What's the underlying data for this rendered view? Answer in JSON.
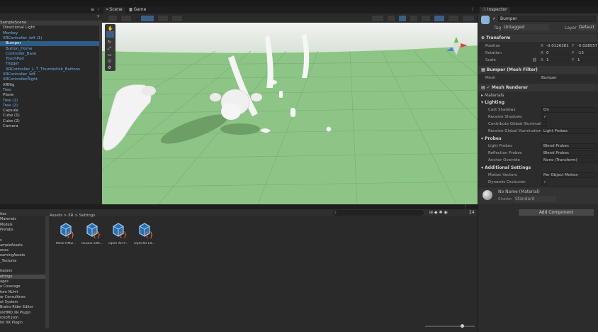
{
  "hierarchy": {
    "tab_icons": [
      "≡",
      "⋮"
    ],
    "plus_icon": "+",
    "items": [
      {
        "label": "SampleScene",
        "cls": "scene",
        "indent": 0
      },
      {
        "label": "Directional Light",
        "cls": "",
        "indent": 4
      },
      {
        "label": "Monkey",
        "cls": "blue",
        "indent": 4
      },
      {
        "label": "XRController_left (1)",
        "cls": "blue",
        "indent": 4
      },
      {
        "label": "Bumper",
        "cls": "blue sel",
        "indent": 8
      },
      {
        "label": "Button_Home",
        "cls": "blue",
        "indent": 8
      },
      {
        "label": "Controller_Base",
        "cls": "blue",
        "indent": 8
      },
      {
        "label": "TouchPad",
        "cls": "blue",
        "indent": 8
      },
      {
        "label": "Trigger",
        "cls": "blue",
        "indent": 8
      },
      {
        "label": "XRController_L_T_Thumbstick_Buttons",
        "cls": "blue",
        "indent": 8
      },
      {
        "label": "XRController_left",
        "cls": "blue",
        "indent": 4
      },
      {
        "label": "XRControllerRight",
        "cls": "blue",
        "indent": 4
      },
      {
        "label": "XRRig",
        "cls": "",
        "indent": 4
      },
      {
        "label": "Tree",
        "cls": "blue",
        "indent": 4
      },
      {
        "label": "Plane",
        "cls": "",
        "indent": 4
      },
      {
        "label": "Tree (1)",
        "cls": "blue",
        "indent": 4
      },
      {
        "label": "Tree (2)",
        "cls": "blue",
        "indent": 4
      },
      {
        "label": "Capsule",
        "cls": "",
        "indent": 4
      },
      {
        "label": "Cube (1)",
        "cls": "",
        "indent": 4
      },
      {
        "label": "Cube (2)",
        "cls": "",
        "indent": 4
      },
      {
        "label": "Camera",
        "cls": "",
        "indent": 4
      }
    ]
  },
  "scene": {
    "tabs": [
      {
        "label": "Scene",
        "active": true
      },
      {
        "label": "Game",
        "active": false
      }
    ],
    "persp_label": "",
    "toolbar_right": [
      "2D",
      "☀",
      "◉",
      "⊞",
      "▾"
    ]
  },
  "inspector": {
    "tab": "Inspector",
    "object_name": "Bumper",
    "tag_label": "Tag",
    "tag_value": "Untagged",
    "layer_label": "Layer",
    "layer_value": "Default",
    "transform": {
      "title": "Transform",
      "rows": [
        {
          "label": "Position",
          "x": "-0.0126381",
          "y": "-0.028557",
          "z": ""
        },
        {
          "label": "Rotation",
          "x": "0",
          "y": "-15",
          "z": ""
        },
        {
          "label": "Scale",
          "x": "1",
          "y": "1",
          "z": ""
        }
      ]
    },
    "mesh_filter": {
      "title": "Bumper (Mesh Filter)",
      "mesh_label": "Mesh",
      "mesh_value": "Bumper"
    },
    "mesh_renderer": {
      "title": "Mesh Renderer",
      "materials": "Materials",
      "lighting": "Lighting",
      "lighting_rows": [
        {
          "label": "Cast Shadows",
          "value": "On"
        },
        {
          "label": "Receive Shadows",
          "value": "✓"
        },
        {
          "label": "Contribute Global Illumination",
          "value": ""
        },
        {
          "label": "Receive Global Illumination",
          "value": "Light Probes"
        }
      ],
      "probes": "Probes",
      "probes_rows": [
        {
          "label": "Light Probes",
          "value": "Blend Probes"
        },
        {
          "label": "Reflection Probes",
          "value": "Blend Probes"
        },
        {
          "label": "Anchor Override",
          "value": "None (Transform)"
        }
      ],
      "additional": "Additional Settings",
      "additional_rows": [
        {
          "label": "Motion Vectors",
          "value": "Per Object Motion"
        },
        {
          "label": "Dynamic Occlusion",
          "value": "✓"
        }
      ]
    },
    "material": {
      "name": "No Name (Material)",
      "shader_label": "Shader",
      "shader_value": "Standard"
    },
    "add_component": "Add Component"
  },
  "project": {
    "breadcrumb": "Assets > XR > Settings",
    "left_items": [
      "ites",
      "Materials",
      "Models",
      "Prefabs",
      "",
      "s",
      "ampleAssets",
      "enes",
      "earningAssets",
      "_Textures",
      "",
      "haders",
      "ettings",
      "ages",
      "e Coverage",
      "tom NUnit",
      "or Consultines",
      "ut System",
      "Brains Rider Editor",
      "nkHMD XR Plugin",
      "rosoft Json",
      "hit XR Plugin"
    ],
    "assets": [
      {
        "label": "Mock HMD..."
      },
      {
        "label": "Oculus Sett..."
      },
      {
        "label": "Open XR P..."
      },
      {
        "label": "OpenXR Ed..."
      }
    ],
    "count": "24"
  }
}
